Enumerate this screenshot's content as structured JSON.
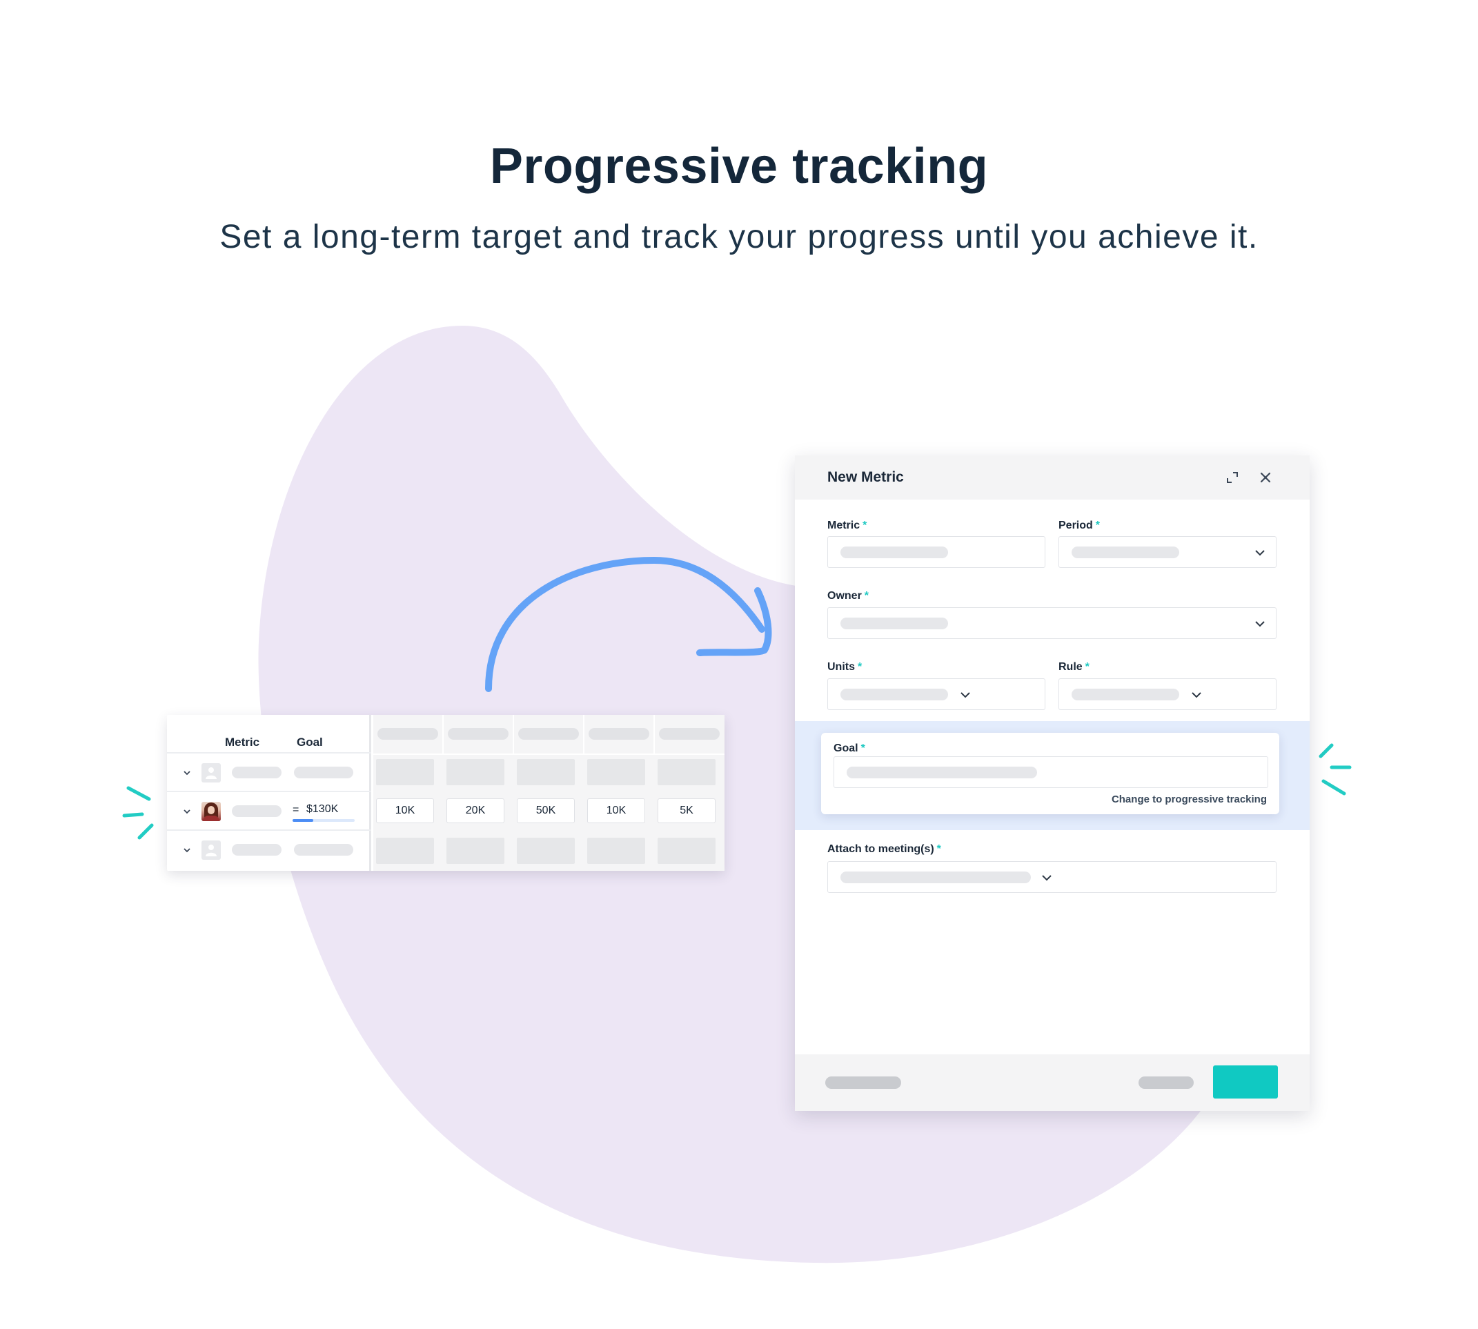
{
  "hero": {
    "title": "Progressive tracking",
    "subtitle": "Set a long-term target and track your progress until you achieve it."
  },
  "colors": {
    "blob": "#ede6f5",
    "accent_teal": "#10c9c2",
    "arrow_blue": "#64a3f7",
    "goal_highlight": "#e3ecfc",
    "text_dark": "#1b2838"
  },
  "table": {
    "headers": {
      "metric": "Metric",
      "goal": "Goal"
    },
    "rows": [
      {
        "type": "placeholder",
        "avatar": "user-icon"
      },
      {
        "type": "filled",
        "avatar": "person-photo",
        "goal_prefix": "=",
        "goal_value": "$130K",
        "goal_progress": 0.33,
        "cells": [
          "10K",
          "20K",
          "50K",
          "10K",
          "5K"
        ]
      },
      {
        "type": "placeholder",
        "avatar": "user-icon"
      }
    ]
  },
  "modal": {
    "title": "New Metric",
    "icons": {
      "expand": "expand-icon",
      "close": "close-icon"
    },
    "required_marker": "*",
    "fields": {
      "metric": "Metric",
      "period": "Period",
      "owner": "Owner",
      "units": "Units",
      "rule": "Rule",
      "goal": "Goal",
      "attach": "Attach to meeting(s)"
    },
    "progressive_link": "Change to progressive tracking"
  }
}
